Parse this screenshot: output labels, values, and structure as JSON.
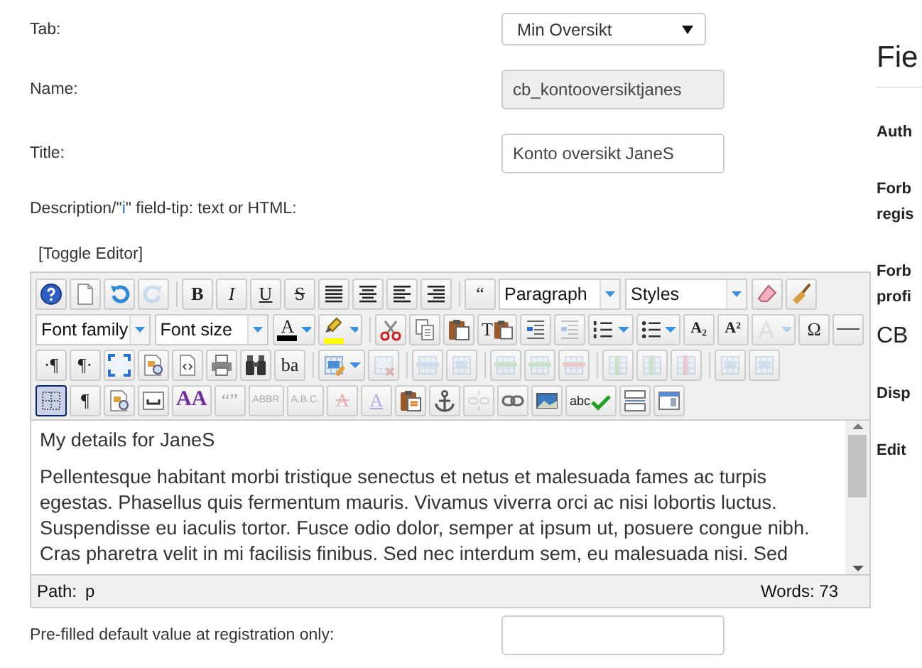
{
  "form": {
    "fields": [
      {
        "kind": "select",
        "label": "Tab:",
        "value": "Min Oversikt"
      },
      {
        "kind": "readonly",
        "label": "Name:",
        "value": "cb_kontooversiktjanes"
      },
      {
        "kind": "text",
        "label": "Title:",
        "value": "Konto oversikt JaneS"
      }
    ],
    "description": {
      "before": "Description/\"",
      "link": "i",
      "after": "\" field-tip: text or HTML:"
    },
    "editor": {
      "toggle": "[Toggle Editor]",
      "toolbar": [
        [
          {
            "kind": "help",
            "disabled": false,
            "active": false
          },
          {
            "kind": "newdoc",
            "disabled": false,
            "active": false
          },
          {
            "kind": "undo",
            "disabled": false,
            "active": false
          },
          {
            "kind": "redo",
            "disabled": true,
            "active": false
          },
          {
            "kind": "sep"
          },
          {
            "kind": "bold",
            "label": "B",
            "disabled": false,
            "active": false
          },
          {
            "kind": "italic",
            "label": "I",
            "disabled": false,
            "active": false
          },
          {
            "kind": "underline",
            "label": "U",
            "disabled": false,
            "active": false
          },
          {
            "kind": "strike",
            "label": "S",
            "disabled": false,
            "active": false
          },
          {
            "kind": "justify",
            "disabled": false,
            "active": false
          },
          {
            "kind": "center",
            "disabled": false,
            "active": false
          },
          {
            "kind": "left",
            "disabled": false,
            "active": false
          },
          {
            "kind": "right",
            "disabled": false,
            "active": false
          },
          {
            "kind": "sep"
          },
          {
            "kind": "quote",
            "label": "“",
            "disabled": false,
            "active": false
          },
          {
            "kind": "select",
            "label": "Paragraph"
          },
          {
            "kind": "select",
            "label": "Styles"
          },
          {
            "kind": "eraser",
            "disabled": false,
            "active": false
          },
          {
            "kind": "broom",
            "disabled": false,
            "active": false
          }
        ],
        [
          {
            "kind": "select",
            "label": "Font family"
          },
          {
            "kind": "select",
            "label": "Font size"
          },
          {
            "kind": "forecolor",
            "label": "A",
            "color": "#000000",
            "split": true,
            "disabled": false,
            "active": false
          },
          {
            "kind": "highlight",
            "color": "#ffff00",
            "split": true,
            "disabled": false,
            "active": false
          },
          {
            "kind": "sep"
          },
          {
            "kind": "cut",
            "disabled": false,
            "active": false
          },
          {
            "kind": "copy",
            "disabled": false,
            "active": false
          },
          {
            "kind": "paste",
            "disabled": false,
            "active": false
          },
          {
            "kind": "pastetext",
            "label": "T",
            "disabled": false,
            "active": false
          },
          {
            "kind": "indent",
            "disabled": false,
            "active": false
          },
          {
            "kind": "outdent",
            "disabled": true,
            "active": false
          },
          {
            "kind": "numlist",
            "split": true,
            "disabled": false,
            "active": false
          },
          {
            "kind": "bullist",
            "split": true,
            "disabled": false,
            "active": false
          },
          {
            "kind": "sub",
            "label": "A₂",
            "disabled": false,
            "active": false
          },
          {
            "kind": "sup",
            "label": "A²",
            "disabled": false,
            "active": false
          },
          {
            "kind": "fontstyle",
            "split": true,
            "disabled": true,
            "active": false
          },
          {
            "kind": "charmap",
            "label": "Ω",
            "disabled": false,
            "active": false
          },
          {
            "kind": "hr",
            "disabled": false,
            "active": false
          }
        ],
        [
          {
            "kind": "ltr",
            "label": "·¶",
            "disabled": false,
            "active": false
          },
          {
            "kind": "rtl",
            "label": "¶·",
            "disabled": false,
            "active": false
          },
          {
            "kind": "fullscreen",
            "disabled": false,
            "active": false
          },
          {
            "kind": "preview",
            "disabled": false,
            "active": false
          },
          {
            "kind": "code",
            "disabled": false,
            "active": false
          },
          {
            "kind": "print",
            "disabled": false,
            "active": false
          },
          {
            "kind": "search",
            "disabled": false,
            "active": false
          },
          {
            "kind": "replace",
            "label": "ba",
            "disabled": false,
            "active": false
          },
          {
            "kind": "sep"
          },
          {
            "kind": "table",
            "split": true,
            "disabled": false,
            "active": false
          },
          {
            "kind": "deltable",
            "disabled": true,
            "active": false
          },
          {
            "kind": "sep"
          },
          {
            "kind": "rowprops",
            "disabled": true,
            "active": false
          },
          {
            "kind": "cellprops",
            "disabled": true,
            "active": false
          },
          {
            "kind": "sep"
          },
          {
            "kind": "rowbefore",
            "disabled": true,
            "active": false
          },
          {
            "kind": "rowafter",
            "disabled": true,
            "active": false
          },
          {
            "kind": "delrow",
            "disabled": true,
            "active": false
          },
          {
            "kind": "sep"
          },
          {
            "kind": "colbefore",
            "disabled": true,
            "active": false
          },
          {
            "kind": "colafter",
            "disabled": true,
            "active": false
          },
          {
            "kind": "delcol",
            "disabled": true,
            "active": false
          },
          {
            "kind": "sep"
          },
          {
            "kind": "splitcells",
            "disabled": true,
            "active": false
          },
          {
            "kind": "mergecells",
            "disabled": true,
            "active": false
          }
        ],
        [
          {
            "kind": "visualaid",
            "disabled": false,
            "active": true
          },
          {
            "kind": "visualchars",
            "label": "¶",
            "disabled": false,
            "active": false
          },
          {
            "kind": "template",
            "disabled": false,
            "active": false
          },
          {
            "kind": "nonbreaking",
            "disabled": false,
            "active": false
          },
          {
            "kind": "styleprops",
            "label": "AA",
            "disabled": false,
            "active": false
          },
          {
            "kind": "cite",
            "label": "“”",
            "disabled": true,
            "active": false
          },
          {
            "kind": "abbr",
            "label": "ABBR",
            "disabled": true,
            "active": false
          },
          {
            "kind": "acronym",
            "label": "A.B.C.",
            "disabled": true,
            "active": false
          },
          {
            "kind": "del",
            "label": "A",
            "disabled": true,
            "active": false
          },
          {
            "kind": "ins",
            "label": "A",
            "disabled": true,
            "active": false
          },
          {
            "kind": "attribs",
            "disabled": false,
            "active": false
          },
          {
            "kind": "anchor",
            "disabled": false,
            "active": false
          },
          {
            "kind": "unlink",
            "disabled": true,
            "active": false
          },
          {
            "kind": "link",
            "disabled": false,
            "active": false
          },
          {
            "kind": "image",
            "disabled": false,
            "active": false
          },
          {
            "kind": "spell",
            "label": "abc",
            "disabled": false,
            "active": false
          },
          {
            "kind": "pagebreak",
            "disabled": false,
            "active": false
          },
          {
            "kind": "layer",
            "disabled": false,
            "active": false
          }
        ]
      ],
      "heading": "My details for JaneS",
      "paragraph": "Pellentesque habitant morbi tristique senectus et netus et malesuada fames ac turpis egestas. Phasellus quis fermentum mauris. Vivamus viverra orci ac nisi lobortis luctus. Suspendisse eu iaculis tortor. Fusce odio dolor, semper at ipsum ut, posuere congue nibh. Cras pharetra velit in mi facilisis finibus. Sed nec interdum sem, eu malesuada nisi. Sed",
      "status": {
        "path_label": "Path:",
        "path": "p",
        "words": "Words: 73"
      }
    },
    "prefilled": {
      "label": "Pre-filled default value at registration only:"
    }
  },
  "sidebar": {
    "heading": "Fie",
    "items": [
      {
        "kind": "label",
        "text": "Auth"
      },
      {
        "kind": "label",
        "text": "Forb",
        "more": "regis"
      },
      {
        "kind": "label",
        "text": "Forb",
        "more": "profi"
      },
      {
        "kind": "section",
        "text": "CB"
      },
      {
        "kind": "label",
        "text": "Disp"
      },
      {
        "kind": "label",
        "text": "Edit"
      }
    ]
  }
}
